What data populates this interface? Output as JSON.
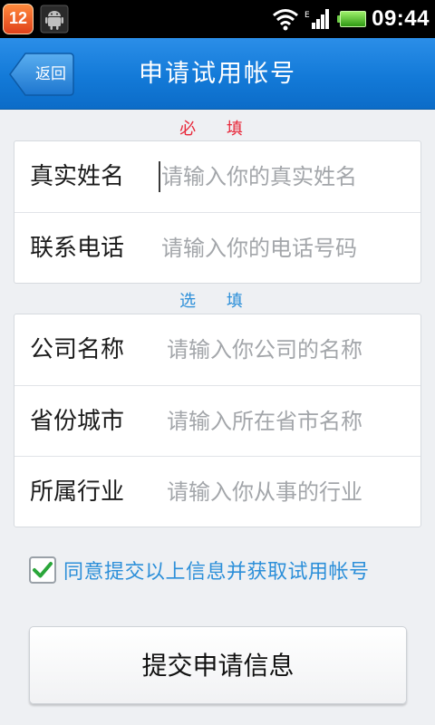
{
  "status_bar": {
    "notification_count": "12",
    "time": "09:44",
    "icons": [
      "android-icon",
      "wifi-icon",
      "signal-icon",
      "battery-icon"
    ]
  },
  "header": {
    "back_label": "返回",
    "title": "申请试用帐号",
    "color": "#1a80dc"
  },
  "required_section": {
    "label": "必 填",
    "fields": [
      {
        "label": "真实姓名",
        "placeholder": "请输入你的真实姓名"
      },
      {
        "label": "联系电话",
        "placeholder": "请输入你的电话号码"
      }
    ]
  },
  "optional_section": {
    "label": "选 填",
    "fields": [
      {
        "label": "公司名称",
        "placeholder": "请输入你公司的名称"
      },
      {
        "label": "省份城市",
        "placeholder": "请输入所在省市名称"
      },
      {
        "label": "所属行业",
        "placeholder": "请输入你从事的行业"
      }
    ]
  },
  "agreement": {
    "checked": true,
    "text": "同意提交以上信息并获取试用帐号"
  },
  "submit": {
    "label": "提交申请信息"
  },
  "colors": {
    "required_accent": "#e8283a",
    "optional_accent": "#2c8fd9"
  }
}
